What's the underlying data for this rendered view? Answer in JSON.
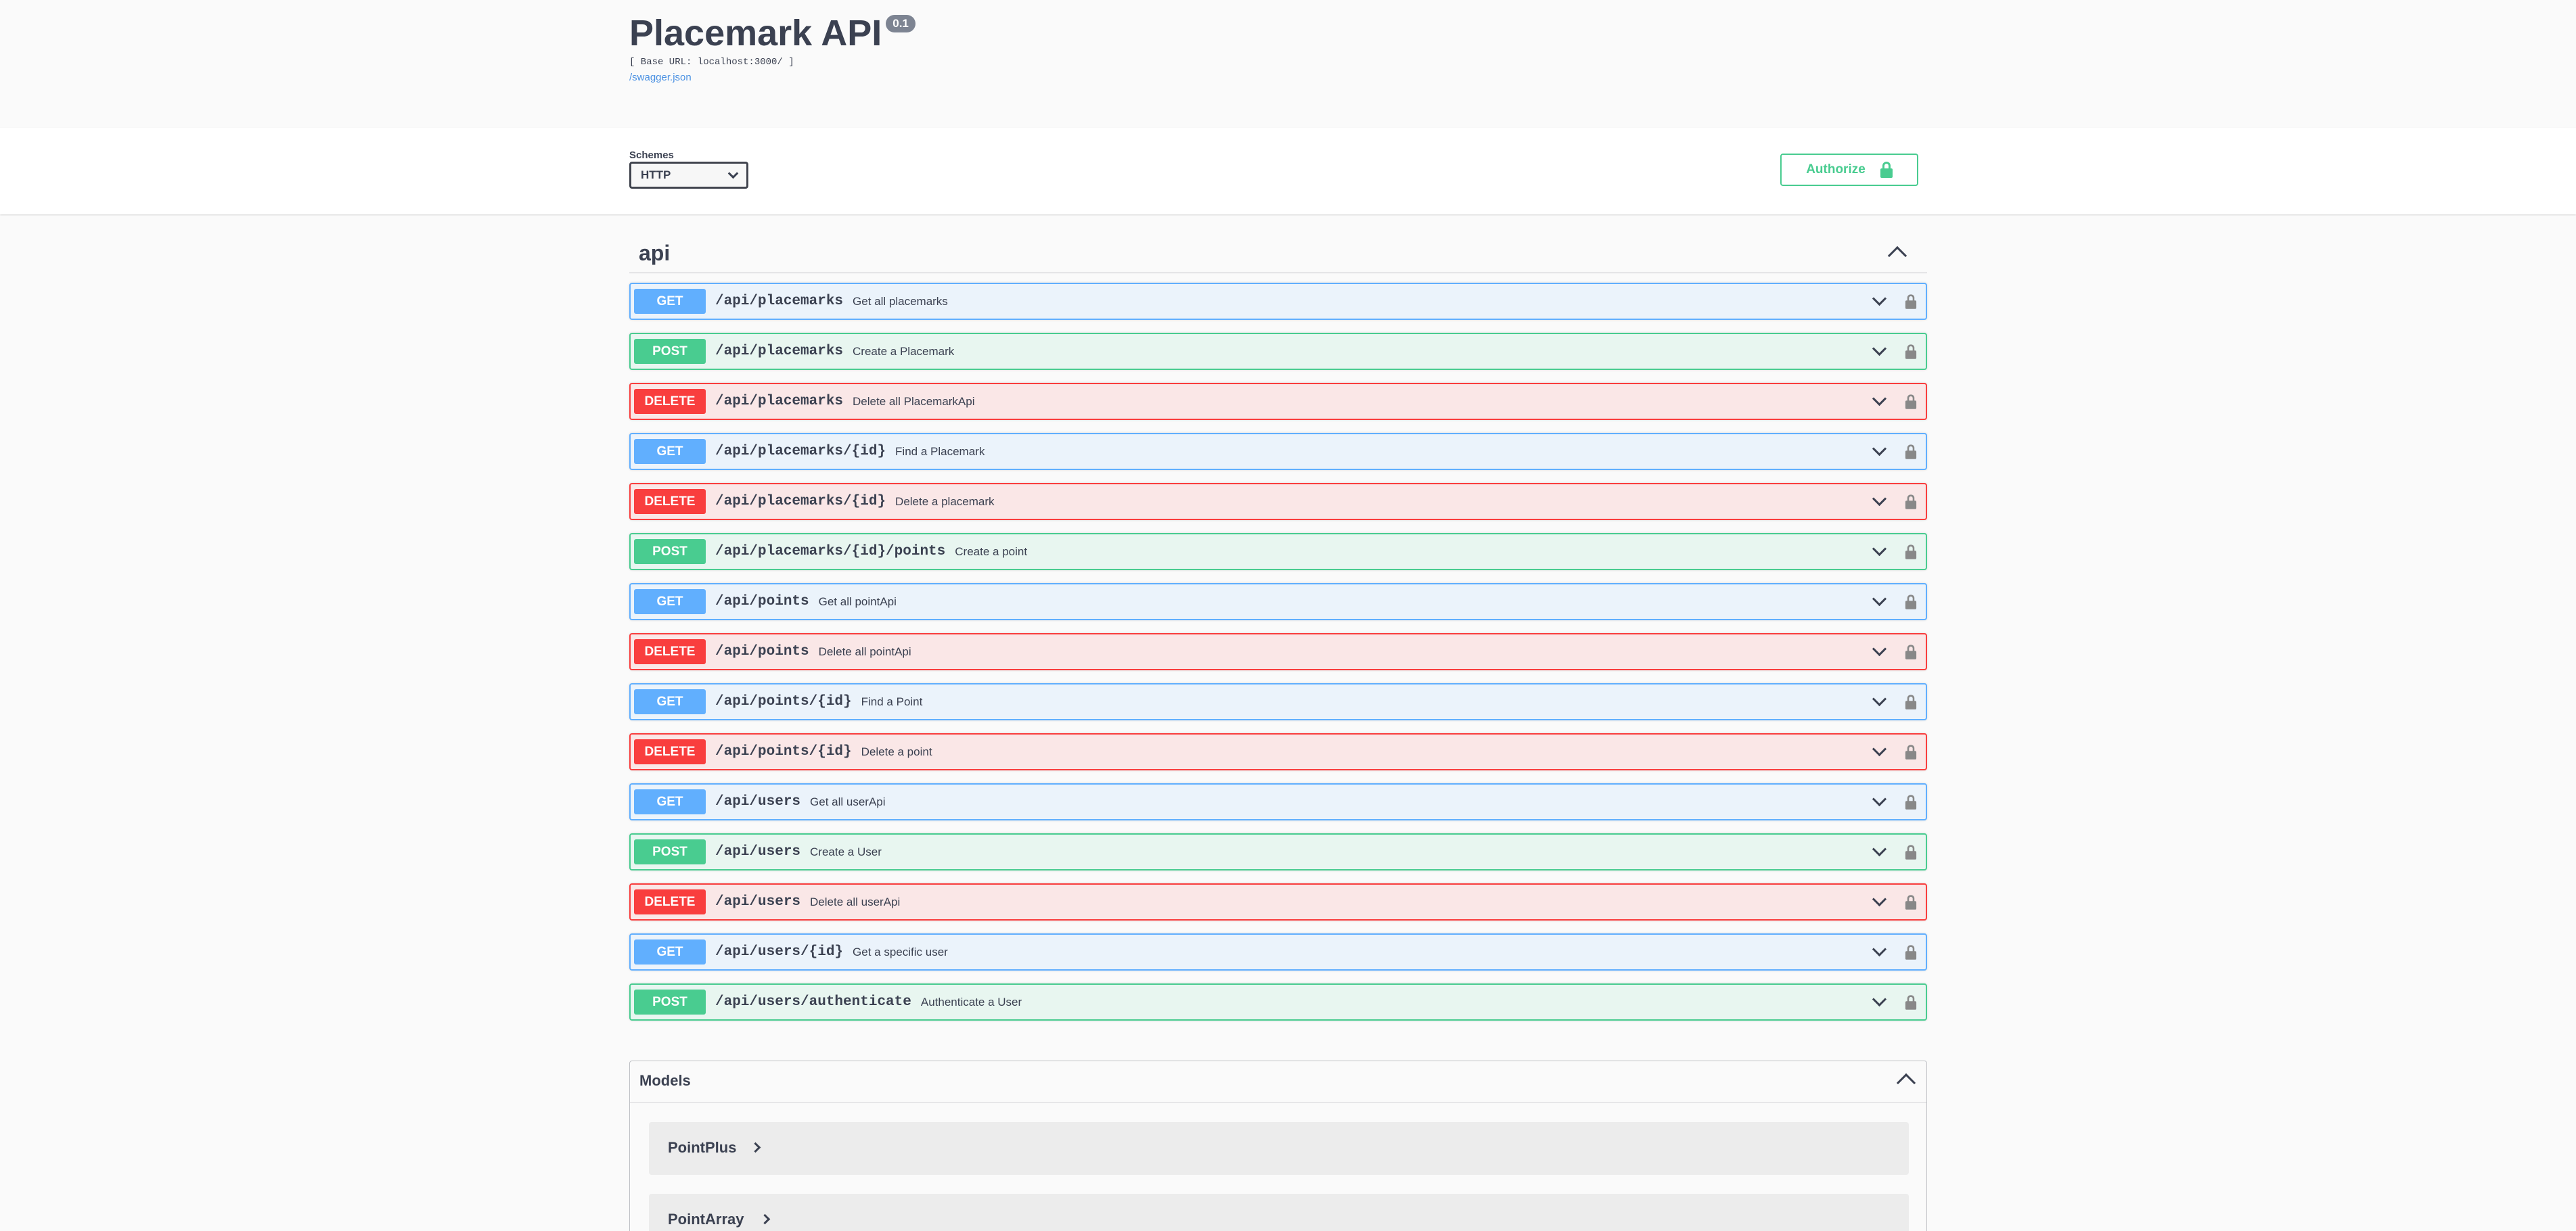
{
  "info": {
    "title": "Placemark API",
    "version": "0.1",
    "base_url": "[ Base URL: localhost:3000/ ]",
    "spec_link": "/swagger.json"
  },
  "scheme_bar": {
    "label": "Schemes",
    "selected": "HTTP",
    "authorize_label": "Authorize"
  },
  "tag": {
    "name": "api"
  },
  "operations": [
    {
      "method": "GET",
      "path": "/api/placemarks",
      "summary": "Get all placemarks"
    },
    {
      "method": "POST",
      "path": "/api/placemarks",
      "summary": "Create a Placemark"
    },
    {
      "method": "DELETE",
      "path": "/api/placemarks",
      "summary": "Delete all PlacemarkApi"
    },
    {
      "method": "GET",
      "path": "/api/placemarks/{id}",
      "summary": "Find a Placemark"
    },
    {
      "method": "DELETE",
      "path": "/api/placemarks/{id}",
      "summary": "Delete a placemark"
    },
    {
      "method": "POST",
      "path": "/api/placemarks/{id}/points",
      "summary": "Create a point"
    },
    {
      "method": "GET",
      "path": "/api/points",
      "summary": "Get all pointApi"
    },
    {
      "method": "DELETE",
      "path": "/api/points",
      "summary": "Delete all pointApi"
    },
    {
      "method": "GET",
      "path": "/api/points/{id}",
      "summary": "Find a Point"
    },
    {
      "method": "DELETE",
      "path": "/api/points/{id}",
      "summary": "Delete a point"
    },
    {
      "method": "GET",
      "path": "/api/users",
      "summary": "Get all userApi"
    },
    {
      "method": "POST",
      "path": "/api/users",
      "summary": "Create a User"
    },
    {
      "method": "DELETE",
      "path": "/api/users",
      "summary": "Delete all userApi"
    },
    {
      "method": "GET",
      "path": "/api/users/{id}",
      "summary": "Get a specific user"
    },
    {
      "method": "POST",
      "path": "/api/users/authenticate",
      "summary": "Authenticate a User"
    }
  ],
  "models": {
    "label": "Models",
    "items": [
      "PointPlus",
      "PointArray"
    ]
  },
  "colors": {
    "get": "#61affe",
    "post": "#49cc90",
    "delete": "#f93e3e",
    "authorize": "#49cc90"
  }
}
